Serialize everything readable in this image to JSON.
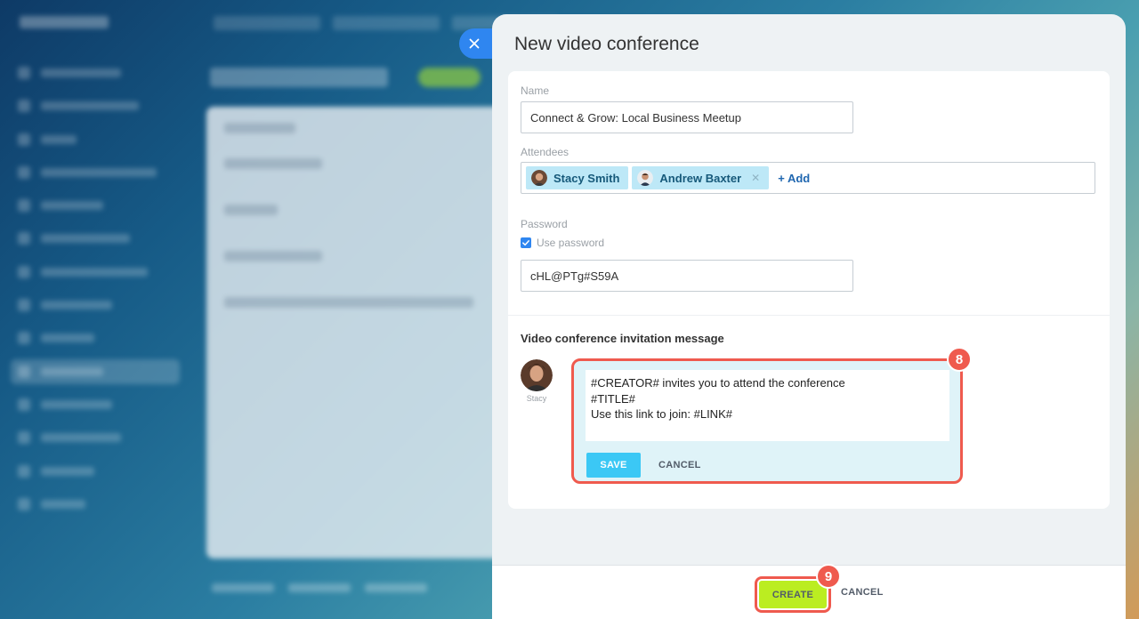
{
  "slider": {
    "title": "New video conference"
  },
  "form": {
    "name_label": "Name",
    "name_value": "Connect & Grow: Local Business Meetup",
    "attendees_label": "Attendees",
    "attendees": [
      {
        "name": "Stacy Smith",
        "removable": false
      },
      {
        "name": "Andrew Baxter",
        "removable": true
      }
    ],
    "add_label": "+ Add",
    "password_label": "Password",
    "use_password_label": "Use password",
    "use_password_checked": true,
    "password_value": "cHL@PTg#S59A"
  },
  "invitation": {
    "section_title": "Video conference invitation message",
    "author_name": "Stacy",
    "message": "#CREATOR# invites you to attend the conference\n#TITLE#\nUse this link to join: #LINK#",
    "save_label": "SAVE",
    "cancel_label": "CANCEL",
    "step_badge": "8"
  },
  "footer": {
    "create_label": "CREATE",
    "cancel_label": "CANCEL",
    "step_badge": "9"
  },
  "colors": {
    "accent_blue": "#2f86f0",
    "highlight_red": "#ef5a4e",
    "create_green": "#bbed21",
    "save_cyan": "#3bc8f5",
    "chip_bg": "#bde8f7"
  },
  "icons": {
    "close": "close-icon",
    "checkbox": "check-icon"
  }
}
